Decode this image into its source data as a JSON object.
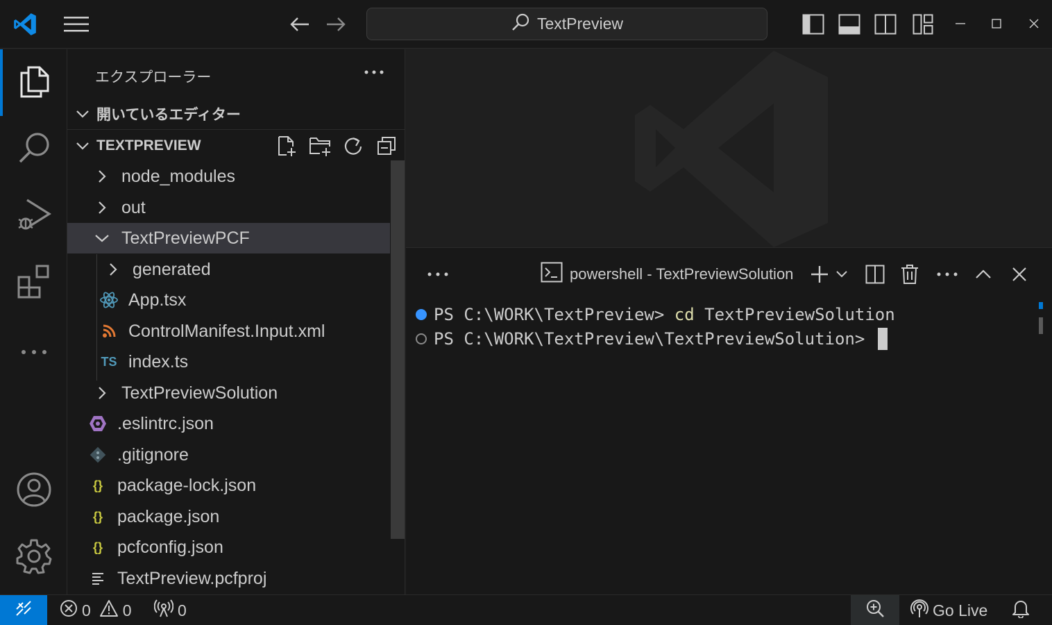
{
  "titlebar": {
    "search_text": "TextPreview"
  },
  "sidebar": {
    "title": "エクスプローラー",
    "open_editors_label": "開いているエディター",
    "project_label": "TEXTPREVIEW",
    "tree": [
      {
        "label": "node_modules",
        "icon": "chevron-right-icon"
      },
      {
        "label": "out",
        "icon": "chevron-right-icon"
      },
      {
        "label": "TextPreviewPCF",
        "icon": "chevron-down-icon"
      },
      {
        "label": "generated",
        "icon": "chevron-right-icon"
      },
      {
        "label": "App.tsx",
        "icon": "react-icon"
      },
      {
        "label": "ControlManifest.Input.xml",
        "icon": "rss-icon"
      },
      {
        "label": "index.ts",
        "icon": "typescript-icon",
        "icon_text": "TS"
      },
      {
        "label": "TextPreviewSolution",
        "icon": "chevron-right-icon"
      },
      {
        "label": ".eslintrc.json",
        "icon": "eslint-icon"
      },
      {
        "label": ".gitignore",
        "icon": "git-icon"
      },
      {
        "label": "package-lock.json",
        "icon": "json-braces-icon",
        "icon_text": "{}"
      },
      {
        "label": "package.json",
        "icon": "json-braces-icon",
        "icon_text": "{}"
      },
      {
        "label": "pcfconfig.json",
        "icon": "json-braces-icon",
        "icon_text": "{}"
      },
      {
        "label": "TextPreview.pcfproj",
        "icon": "lines-icon"
      }
    ]
  },
  "panel": {
    "terminal_title": "powershell - TextPreviewSolution",
    "lines": [
      {
        "prompt": "PS C:\\WORK\\TextPreview> ",
        "command": "cd",
        "args": " TextPreviewSolution"
      },
      {
        "prompt": "PS C:\\WORK\\TextPreview\\TextPreviewSolution> ",
        "command": "",
        "args": ""
      }
    ]
  },
  "statusbar": {
    "errors": "0",
    "warnings": "0",
    "ports": "0",
    "go_live": "Go Live"
  },
  "colors": {
    "accent": "#0078d4",
    "json_icon": "#cbcb41",
    "eslint_icon": "#a074c4",
    "react_icon": "#519aba",
    "rss_icon": "#e37933",
    "ts_icon": "#519aba"
  }
}
